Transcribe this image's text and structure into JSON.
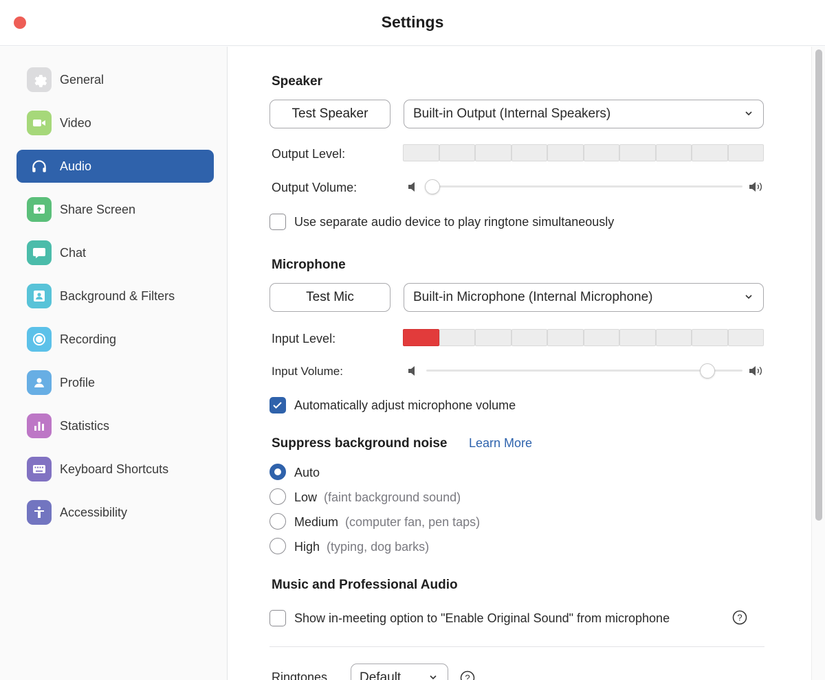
{
  "window": {
    "title": "Settings",
    "close_color": "#ee5e56"
  },
  "sidebar": {
    "active_color": "#2f62ab",
    "items": [
      {
        "label": "General",
        "icon": "gear-icon"
      },
      {
        "label": "Video",
        "icon": "video-camera-icon"
      },
      {
        "label": "Audio",
        "icon": "headphones-icon",
        "active": true
      },
      {
        "label": "Share Screen",
        "icon": "share-screen-icon"
      },
      {
        "label": "Chat",
        "icon": "chat-bubble-icon"
      },
      {
        "label": "Background & Filters",
        "icon": "background-person-icon"
      },
      {
        "label": "Recording",
        "icon": "record-icon"
      },
      {
        "label": "Profile",
        "icon": "person-icon"
      },
      {
        "label": "Statistics",
        "icon": "bar-chart-icon"
      },
      {
        "label": "Keyboard Shortcuts",
        "icon": "keyboard-icon"
      },
      {
        "label": "Accessibility",
        "icon": "accessibility-icon"
      }
    ]
  },
  "speaker": {
    "title": "Speaker",
    "test_button": "Test Speaker",
    "device": "Built-in Output (Internal Speakers)",
    "output_level_label": "Output Level:",
    "output_level_active_segments": 0,
    "output_volume_label": "Output Volume:",
    "output_volume": 0.02,
    "separate_ringtone_label": "Use separate audio device to play ringtone simultaneously",
    "separate_ringtone_checked": false
  },
  "microphone": {
    "title": "Microphone",
    "test_button": "Test Mic",
    "device": "Built-in Microphone (Internal Microphone)",
    "input_level_label": "Input Level:",
    "input_level_active_segments": 1,
    "input_volume_label": "Input Volume:",
    "input_volume": 0.89,
    "auto_adjust_label": "Automatically adjust microphone volume",
    "auto_adjust_checked": true
  },
  "noise": {
    "title": "Suppress background noise",
    "learn_more": "Learn More",
    "options": [
      {
        "label": "Auto",
        "hint": "",
        "selected": true
      },
      {
        "label": "Low",
        "hint": "(faint background sound)",
        "selected": false
      },
      {
        "label": "Medium",
        "hint": "(computer fan, pen taps)",
        "selected": false
      },
      {
        "label": "High",
        "hint": "(typing, dog barks)",
        "selected": false
      }
    ]
  },
  "music": {
    "title": "Music and Professional Audio",
    "original_sound_label": "Show in-meeting option to \"Enable Original Sound\" from microphone",
    "original_sound_checked": false
  },
  "ringtones": {
    "label": "Ringtones",
    "value": "Default"
  }
}
